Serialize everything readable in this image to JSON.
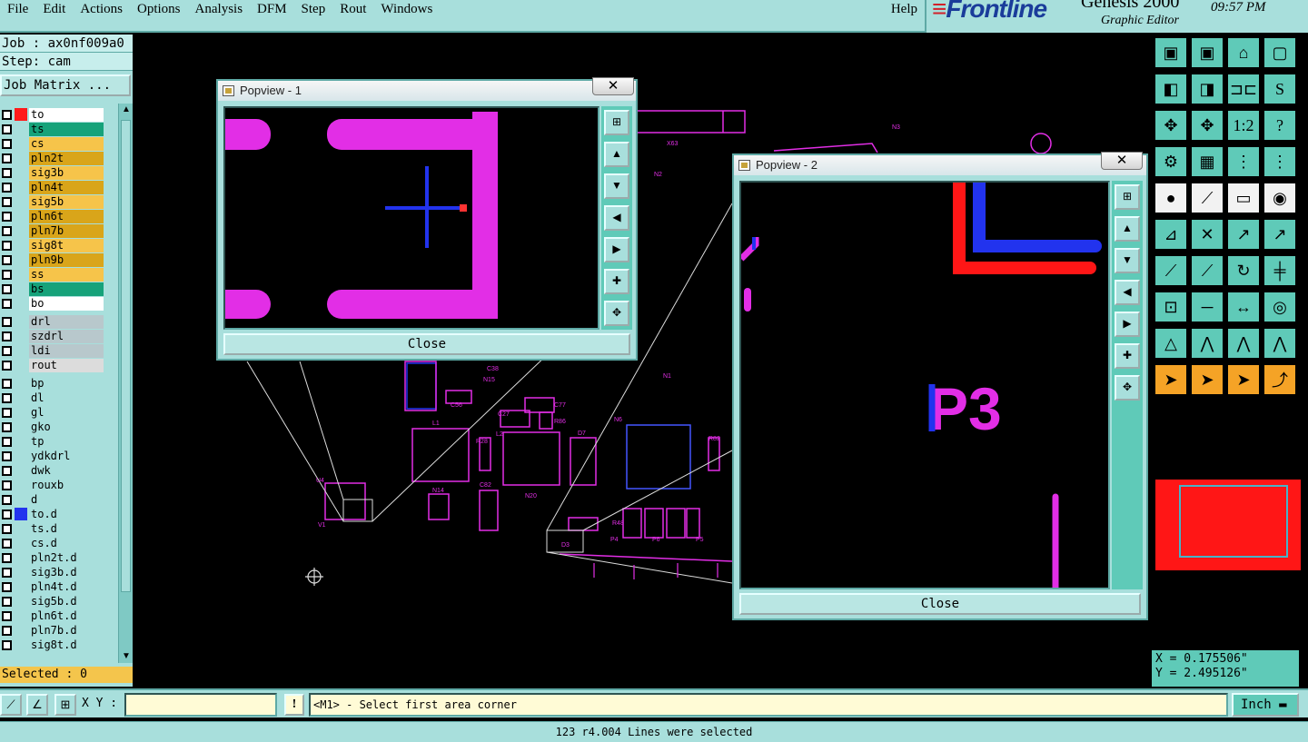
{
  "menubar": {
    "items": [
      "File",
      "Edit",
      "Actions",
      "Options",
      "Analysis",
      "DFM",
      "Step",
      "Rout",
      "Windows"
    ],
    "help": "Help"
  },
  "brand": {
    "logo": "Frontline",
    "product": "Genesis 2000",
    "subtitle": "Graphic Editor",
    "time": "09:57 PM"
  },
  "job": {
    "job_label": "Job : ax0nf009a0",
    "step_label": "Step: cam",
    "matrix_button": "Job Matrix ..."
  },
  "layers": [
    {
      "name": "to",
      "color": "#ffffff",
      "swatch": "#ff1a1a",
      "group": 1,
      "active": true
    },
    {
      "name": "ts",
      "color": "#16a27a",
      "group": 1
    },
    {
      "name": "cs",
      "color": "#f6c44a",
      "group": 1
    },
    {
      "name": "pln2t",
      "color": "#d9a51a",
      "group": 1
    },
    {
      "name": "sig3b",
      "color": "#f6c44a",
      "group": 1
    },
    {
      "name": "pln4t",
      "color": "#d9a51a",
      "group": 1
    },
    {
      "name": "sig5b",
      "color": "#f6c44a",
      "group": 1
    },
    {
      "name": "pln6t",
      "color": "#d9a51a",
      "group": 1
    },
    {
      "name": "pln7b",
      "color": "#d9a51a",
      "group": 1
    },
    {
      "name": "sig8t",
      "color": "#f6c44a",
      "group": 1
    },
    {
      "name": "pln9b",
      "color": "#d9a51a",
      "group": 1
    },
    {
      "name": "ss",
      "color": "#f6c44a",
      "group": 1
    },
    {
      "name": "bs",
      "color": "#16a27a",
      "group": 1
    },
    {
      "name": "bo",
      "color": "#ffffff",
      "group": 1
    },
    {
      "name": "drl",
      "color": "#b8c8cc",
      "group": 2
    },
    {
      "name": "szdrl",
      "color": "#b8c8cc",
      "group": 2
    },
    {
      "name": "ldi",
      "color": "#b8c8cc",
      "group": 2
    },
    {
      "name": "rout",
      "color": "#dcdcdc",
      "group": 2
    },
    {
      "name": "bp",
      "color": "#a8dfdc",
      "group": 3
    },
    {
      "name": "dl",
      "color": "#a8dfdc",
      "group": 3
    },
    {
      "name": "gl",
      "color": "#a8dfdc",
      "group": 3
    },
    {
      "name": "gko",
      "color": "#a8dfdc",
      "group": 3
    },
    {
      "name": "tp",
      "color": "#a8dfdc",
      "group": 3
    },
    {
      "name": "ydkdrl",
      "color": "#a8dfdc",
      "group": 3
    },
    {
      "name": "dwk",
      "color": "#a8dfdc",
      "group": 3
    },
    {
      "name": "rouxb",
      "color": "#a8dfdc",
      "group": 3
    },
    {
      "name": "d",
      "color": "#a8dfdc",
      "group": 3
    },
    {
      "name": "to.d",
      "color": "#a8dfdc",
      "swatch": "#2233ee",
      "group": 3
    },
    {
      "name": "ts.d",
      "color": "#a8dfdc",
      "group": 3
    },
    {
      "name": "cs.d",
      "color": "#a8dfdc",
      "group": 3
    },
    {
      "name": "pln2t.d",
      "color": "#a8dfdc",
      "group": 3
    },
    {
      "name": "sig3b.d",
      "color": "#a8dfdc",
      "group": 3
    },
    {
      "name": "pln4t.d",
      "color": "#a8dfdc",
      "group": 3
    },
    {
      "name": "sig5b.d",
      "color": "#a8dfdc",
      "group": 3
    },
    {
      "name": "pln6t.d",
      "color": "#a8dfdc",
      "group": 3
    },
    {
      "name": "pln7b.d",
      "color": "#a8dfdc",
      "group": 3
    },
    {
      "name": "sig8t.d",
      "color": "#a8dfdc",
      "group": 3
    }
  ],
  "selected_label": "Selected : 0",
  "popview1": {
    "title": "Popview - 1",
    "close": "Close",
    "close_x": "✕"
  },
  "popview2": {
    "title": "Popview - 2",
    "close": "Close",
    "close_x": "✕",
    "board_text": "P3"
  },
  "canvas_labels": [
    "N3",
    "X63",
    "N2",
    "N1",
    "C38",
    "N15",
    "C56",
    "C77",
    "C27",
    "R86",
    "L1",
    "D7",
    "N6",
    "R82",
    "L2",
    "R28",
    "N14",
    "C82",
    "N20",
    "V1",
    "U4",
    "D3",
    "R48",
    "P4",
    "P6",
    "P5"
  ],
  "coords": {
    "x": "X = 0.175506\"",
    "y": "Y = 2.495126\""
  },
  "cmdbar": {
    "xy_label": "X Y :",
    "xy_value": "",
    "warn": "!",
    "prompt": "<M1> - Select first area corner",
    "unit": "Inch"
  },
  "status": "123 r4.004 Lines were selected",
  "colors": {
    "panel": "#a8dfdc",
    "teal": "#5fcab8",
    "magenta": "#e22ee6",
    "red": "#ff1616",
    "blue": "#2233ee"
  }
}
